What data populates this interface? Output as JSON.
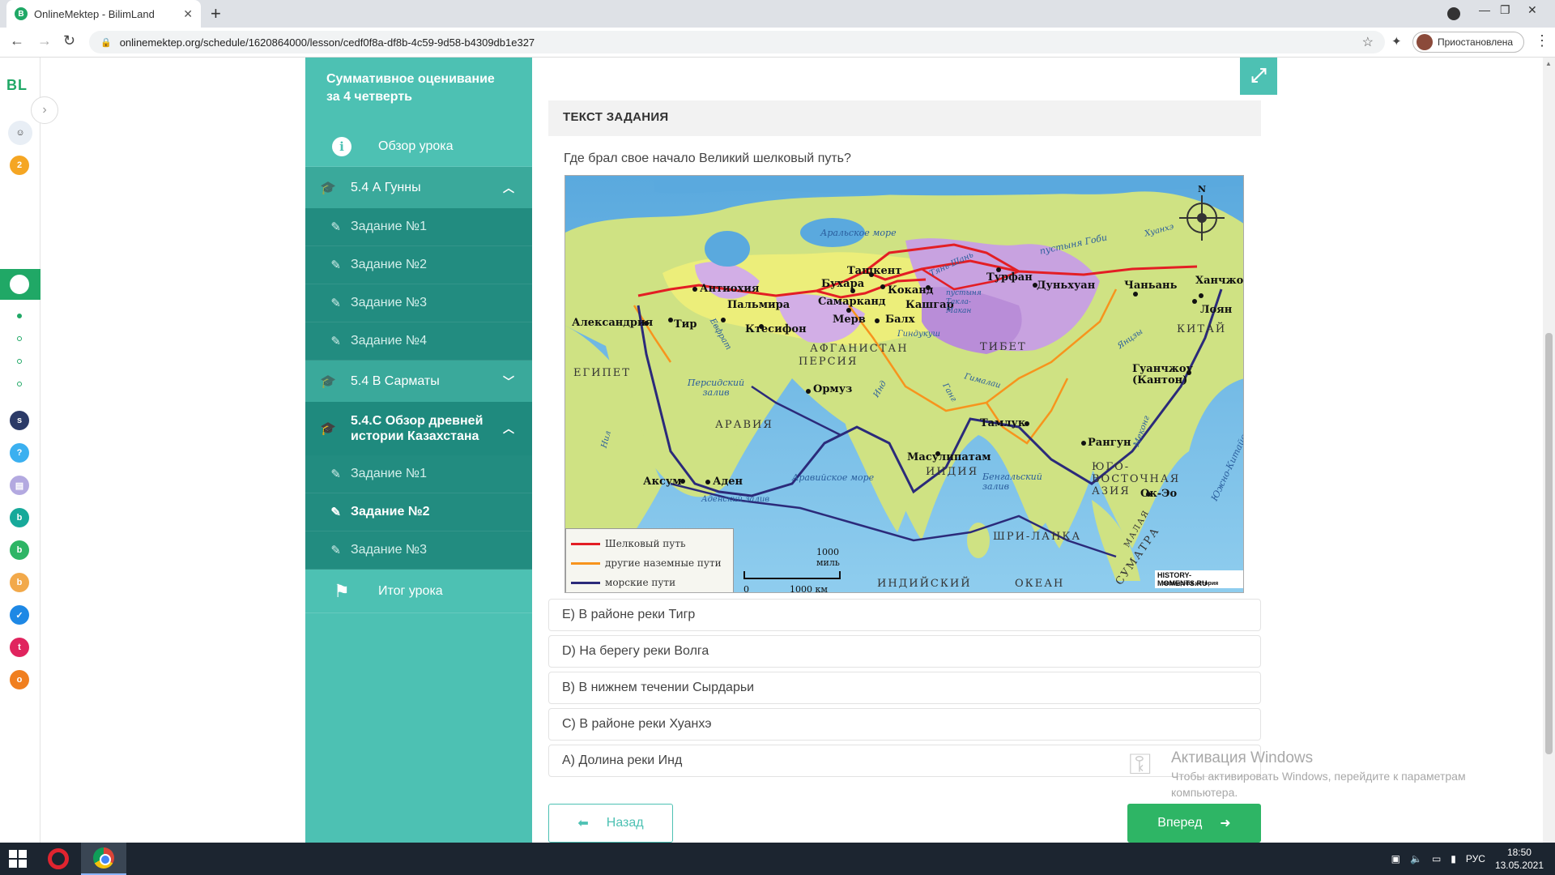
{
  "browser": {
    "tab_title": "OnlineMektep - BilimLand",
    "url": "onlinemektep.org/schedule/1620864000/lesson/cedf0f8a-df8b-4c59-9d58-b4309db1e327",
    "profile_label": "Приостановлена"
  },
  "rail": {
    "logo": "BL",
    "badge_count": "2"
  },
  "sidebar": {
    "lesson_title": "Суммативное оценивание за 4 четверть",
    "overview": "Обзор урока",
    "sections": [
      {
        "label": "5.4 А Гунны",
        "items": [
          "Задание №1",
          "Задание №2",
          "Задание №3",
          "Задание №4"
        ]
      },
      {
        "label": "5.4 В Сарматы"
      },
      {
        "label": "5.4.С Обзор древней истории Казахстана",
        "items": [
          "Задание №1",
          "Задание №2",
          "Задание №3"
        ]
      }
    ],
    "summary": "Итог урока"
  },
  "main": {
    "task_header": "ТЕКСТ ЗАДАНИЯ",
    "question": "Где брал свое начало Великий шелковый путь?",
    "answers": [
      "E) В районе реки Тигр",
      "D) На берегу реки Волга",
      "B) В нижнем течении Сырдарьи",
      "C) В районе реки Хуанхэ",
      "A) Долина реки Инд"
    ],
    "back_label": "Назад",
    "next_label": "Вперед"
  },
  "map": {
    "cities": {
      "aleksandria": "Александрия",
      "antiokhia": "Антиохия",
      "tir": "Тир",
      "palmira": "Пальмира",
      "ktesifon": "Ктесифон",
      "buhara": "Бухара",
      "tashkent": "Ташкент",
      "samarkand": "Самарканд",
      "kokand": "Коканд",
      "merv": "Мерв",
      "kashgar": "Кашгар",
      "balkh": "Балх",
      "turfan": "Турфан",
      "dunhuan": "Дуньхуан",
      "chanan": "Чаньань",
      "hanchzhou": "Ханчжоу",
      "loyan": "Лоян",
      "ormuz": "Ормуз",
      "aksum": "Аксум",
      "aden": "Аден",
      "masulipatam": "Масулипатам",
      "tamluk": "Тамлук",
      "rangun": "Рангун",
      "guanchzhou": "Гуанчжоу (Кантон)",
      "okeo": "Ок-Эо"
    },
    "regions": {
      "egipet": "ЕГИПЕТ",
      "aravia": "АРАВИЯ",
      "persia": "ПЕРСИЯ",
      "afganistan": "АФГАНИСТАН",
      "tibet": "ТИБЕТ",
      "kitai": "КИТАЙ",
      "india": "ИНДИЯ",
      "sri_lanka": "ШРИ-ЛАНКА",
      "sea_asia": "ЮГО-ВОСТОЧНАЯ АЗИЯ",
      "indian": "ИНДИЙСКИЙ",
      "ocean": "ОКЕАН",
      "sumatra": "СУМАТРА",
      "malaya": "МАЛАЯ"
    },
    "waters": {
      "aral": "Аральское море",
      "gobi": "пустыня Гоби",
      "takla": "пустыня Такла-Макан",
      "persian": "Персидский залив",
      "arabian": "Аравийское море",
      "bengal": "Бенгальский залив",
      "sea_china": "Южно-Китайское море",
      "nil": "Нил",
      "evfrat": "Евфрат",
      "ind": "Инд",
      "gang": "Ганг",
      "huanhe": "Хуанхэ",
      "yanczy": "Янцзы",
      "mekong": "Меконг",
      "tyanshan": "Тянь-Шань",
      "gindukush": "Гиндукуш",
      "gimalai": "Гималаи",
      "aden_gulf": "Аденский залив",
      "compass_n": "N"
    },
    "legend": {
      "silk": "Шелковый путь",
      "land": "другие наземные пути",
      "sea": "морские пути",
      "silk_color": "#e31e24",
      "land_color": "#f7941d",
      "sea_color": "#2b2a7a"
    },
    "scale": {
      "miles": "1000 миль",
      "km_zero": "0",
      "km": "1000 км"
    },
    "watermark": "HISTORY-MOMENTS.RU",
    "watermark_sub": "всемирная история"
  },
  "windows": {
    "activation_title": "Активация Windows",
    "activation_text": "Чтобы активировать Windows, перейдите к параметрам компьютера.",
    "lang": "РУС",
    "time": "18:50",
    "date": "13.05.2021"
  },
  "colors": {
    "teal": "#4dc1b3",
    "teal_dark": "#228c80",
    "green_button": "#2eb565"
  }
}
